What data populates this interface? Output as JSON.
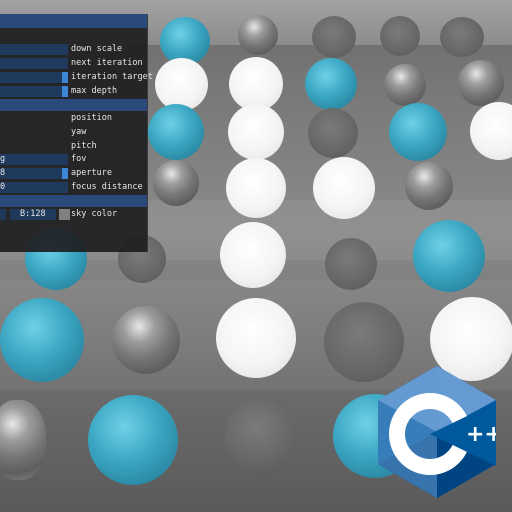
{
  "panel": {
    "fields": {
      "down_scale": "",
      "next_iteration": "",
      "iteration_target": "",
      "max_depth": "",
      "position": "",
      "yaw": "",
      "pitch": "",
      "fov": "g",
      "aperture": "8",
      "focus_distance": "0",
      "sky_b": "B:128"
    },
    "labels": {
      "down_scale": "down scale",
      "next_iteration": "next iteration",
      "iteration_target": "iteration target",
      "max_depth": "max depth",
      "position": "position",
      "yaw": "yaw",
      "pitch": "pitch",
      "fov": "fov",
      "aperture": "aperture",
      "focus_distance": "focus distance",
      "sky_color": "sky color"
    },
    "sky_color": "#808080"
  },
  "colors": {
    "panel_bg": "#1e1e22",
    "header": "#294a7a",
    "field_bg": "#203a5e",
    "slider_grab": "#3d85d6",
    "sphere_blue": "#3aa6c2",
    "cpp_light": "#659ad2",
    "cpp_dark": "#004482",
    "cpp_mid": "#00599c"
  },
  "logo": {
    "letter": "C",
    "suffix": "++"
  }
}
